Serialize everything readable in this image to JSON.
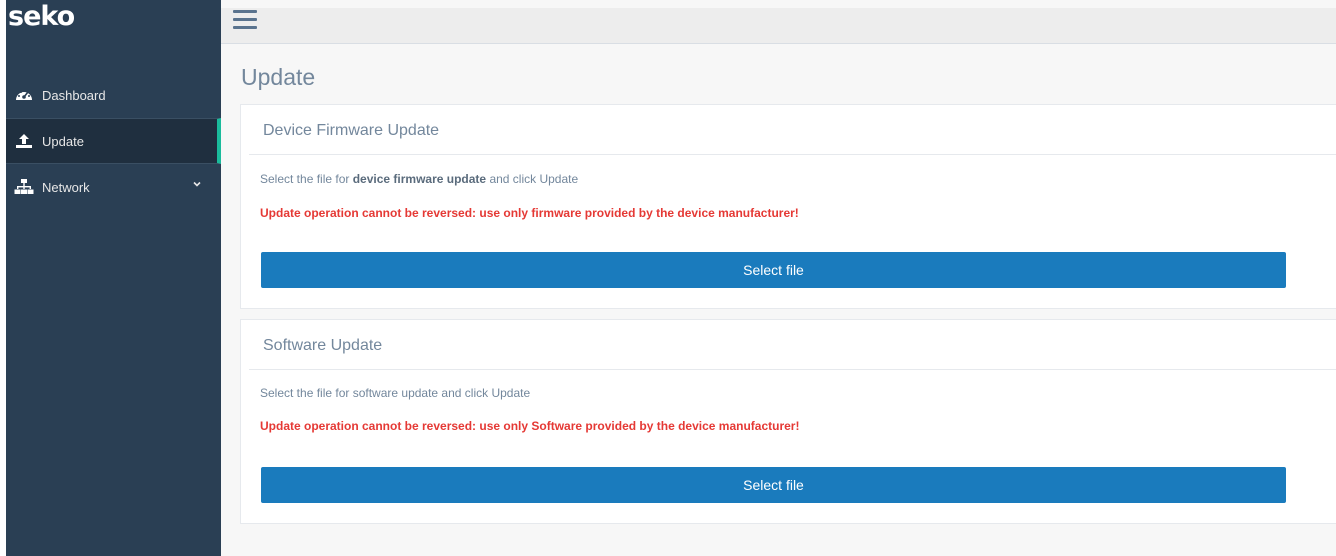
{
  "brand": {
    "logo_text": "seko"
  },
  "sidebar": {
    "items": [
      {
        "label": "Dashboard",
        "icon": "dashboard-icon",
        "active": false
      },
      {
        "label": "Update",
        "icon": "upload-icon",
        "active": true
      },
      {
        "label": "Network",
        "icon": "sitemap-icon",
        "active": false,
        "has_submenu": true
      }
    ]
  },
  "topbar": {
    "menu_icon": "hamburger-icon"
  },
  "page": {
    "title": "Update"
  },
  "panels": [
    {
      "title": "Device Firmware Update",
      "instruction_prefix": "Select the file for ",
      "instruction_bold": "device firmware update",
      "instruction_suffix": " and click Update",
      "warning": "Update operation cannot be reversed: use only firmware provided by the device manufacturer!",
      "button_label": "Select file"
    },
    {
      "title": "Software Update",
      "instruction": "Select the file for software update and click Update",
      "warning": "Update operation cannot be reversed: use only Software provided by the device manufacturer!",
      "button_label": "Select file"
    }
  ],
  "colors": {
    "sidebar_bg": "#2a3f54",
    "accent": "#1abb9c",
    "button": "#1a7bbd",
    "warning": "#e53935"
  }
}
